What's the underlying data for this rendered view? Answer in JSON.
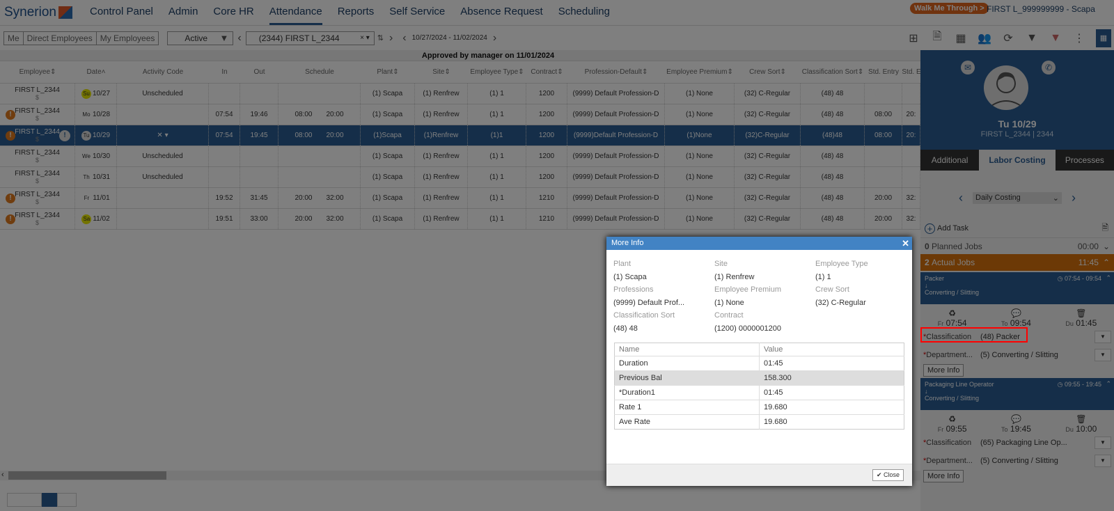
{
  "brand": "Synerion",
  "nav": [
    "Control Panel",
    "Admin",
    "Core HR",
    "Attendance",
    "Reports",
    "Self Service",
    "Absence Request",
    "Scheduling"
  ],
  "nav_active": "Attendance",
  "walk_me": "Walk Me Through >",
  "user": "FIRST L_999999999 - Scapa",
  "toolbar": {
    "scope": [
      "Me",
      "Direct Employees",
      "My Employees"
    ],
    "status": "Active",
    "employee": "(2344) FIRST L_2344",
    "date_range": "10/27/2024 - 11/02/2024"
  },
  "approval": "Approved by manager on 11/01/2024",
  "columns": [
    "Employee",
    "Date",
    "Activity Code",
    "In",
    "Out",
    "Schedule",
    "Plant",
    "Site",
    "Employee Type",
    "Contract",
    "Profession-Default",
    "Employee Premium",
    "Crew Sort",
    "Classification Sort",
    "Std. Entry",
    "Std. E"
  ],
  "rows": [
    {
      "emp": "FIRST L_2344",
      "day": "Su",
      "date": "10/27",
      "activity": "Unscheduled",
      "in": "",
      "out": "",
      "s1": "",
      "s2": "",
      "plant": "(1) Scapa",
      "site": "(1) Renfrew",
      "type": "(1) 1",
      "contract": "1200",
      "prof": "(9999) Default Profession-D",
      "prem": "(1) None",
      "crew": "(32) C-Regular",
      "cls": "(48) 48",
      "se": "",
      "sx": "",
      "warn": false
    },
    {
      "emp": "FIRST L_2344",
      "day": "Mo",
      "date": "10/28",
      "activity": "",
      "in": "07:54",
      "out": "19:46",
      "s1": "08:00",
      "s2": "20:00",
      "plant": "(1) Scapa",
      "site": "(1) Renfrew",
      "type": "(1) 1",
      "contract": "1200",
      "prof": "(9999) Default Profession-D",
      "prem": "(1) None",
      "crew": "(32) C-Regular",
      "cls": "(48) 48",
      "se": "08:00",
      "sx": "20:",
      "warn": true
    },
    {
      "emp": "FIRST L_2344",
      "day": "Tu",
      "date": "10/29",
      "activity": "✕ ▾",
      "in": "07:54",
      "out": "19:45",
      "s1": "08:00",
      "s2": "20:00",
      "plant": "(1)Scapa",
      "site": "(1)Renfrew",
      "type": "(1)1",
      "contract": "1200",
      "prof": "(9999)Default Profession-D",
      "prem": "(1)None",
      "crew": "(32)C-Regular",
      "cls": "(48)48",
      "se": "08:00",
      "sx": "20:",
      "warn": true,
      "selected": true
    },
    {
      "emp": "FIRST L_2344",
      "day": "We",
      "date": "10/30",
      "activity": "Unscheduled",
      "in": "",
      "out": "",
      "s1": "",
      "s2": "",
      "plant": "(1) Scapa",
      "site": "(1) Renfrew",
      "type": "(1) 1",
      "contract": "1200",
      "prof": "(9999) Default Profession-D",
      "prem": "(1) None",
      "crew": "(32) C-Regular",
      "cls": "(48) 48",
      "se": "",
      "sx": "",
      "warn": false
    },
    {
      "emp": "FIRST L_2344",
      "day": "Th",
      "date": "10/31",
      "activity": "Unscheduled",
      "in": "",
      "out": "",
      "s1": "",
      "s2": "",
      "plant": "(1) Scapa",
      "site": "(1) Renfrew",
      "type": "(1) 1",
      "contract": "1200",
      "prof": "(9999) Default Profession-D",
      "prem": "(1) None",
      "crew": "(32) C-Regular",
      "cls": "(48) 48",
      "se": "",
      "sx": "",
      "warn": false
    },
    {
      "emp": "FIRST L_2344",
      "day": "Fr",
      "date": "11/01",
      "activity": "",
      "in": "19:52",
      "out": "31:45",
      "s1": "20:00",
      "s2": "32:00",
      "plant": "(1) Scapa",
      "site": "(1) Renfrew",
      "type": "(1) 1",
      "contract": "1210",
      "prof": "(9999) Default Profession-D",
      "prem": "(1) None",
      "crew": "(32) C-Regular",
      "cls": "(48) 48",
      "se": "20:00",
      "sx": "32:",
      "warn": true
    },
    {
      "emp": "FIRST L_2344",
      "day": "Sa",
      "date": "11/02",
      "activity": "",
      "in": "19:51",
      "out": "33:00",
      "s1": "20:00",
      "s2": "32:00",
      "plant": "(1) Scapa",
      "site": "(1) Renfrew",
      "type": "(1) 1",
      "contract": "1210",
      "prof": "(9999) Default Profession-D",
      "prem": "(1) None",
      "crew": "(32) C-Regular",
      "cls": "(48) 48",
      "se": "20:00",
      "sx": "32:",
      "warn": true
    }
  ],
  "panel": {
    "day": "Tu 10/29",
    "employee": "FIRST L_2344 | 2344",
    "tabs": [
      "Additional",
      "Labor Costing",
      "Processes"
    ],
    "costing": "Daily Costing",
    "add_task": "Add Task",
    "planned": {
      "count": "0",
      "label": "Planned Jobs",
      "time": "00:00"
    },
    "actual": {
      "count": "2",
      "label": "Actual Jobs",
      "time": "11:45"
    },
    "jobs": [
      {
        "title": "Packer",
        "dept": "Converting / Slitting",
        "range": "07:54 - 09:54",
        "fr": "07:54",
        "to": "09:54",
        "du": "01:45",
        "classification": "(48) Packer",
        "department": "(5) Converting / Slitting"
      },
      {
        "title": "Packaging Line Operator",
        "dept": "Converting / Slitting",
        "range": "09:55 - 19:45",
        "fr": "09:55",
        "to": "19:45",
        "du": "10:00",
        "classification": "(65) Packaging Line Op...",
        "department": "(5) Converting / Slitting"
      }
    ],
    "labels": {
      "fr": "Fr",
      "to": "To",
      "du": "Du",
      "classification": "Classification",
      "department": "Department...",
      "more": "More Info"
    }
  },
  "modal": {
    "title": "More Info",
    "fields": [
      {
        "k": "Plant",
        "v": "(1) Scapa"
      },
      {
        "k": "Site",
        "v": "(1) Renfrew"
      },
      {
        "k": "Employee Type",
        "v": "(1) 1"
      },
      {
        "k": "Professions",
        "v": "(9999) Default Prof..."
      },
      {
        "k": "Employee Premium",
        "v": "(1) None"
      },
      {
        "k": "Crew Sort",
        "v": "(32) C-Regular"
      },
      {
        "k": "Classification Sort",
        "v": "(48) 48"
      },
      {
        "k": "Contract",
        "v": "(1200) 0000001200"
      }
    ],
    "table_headers": [
      "Name",
      "Value"
    ],
    "table": [
      [
        "Duration",
        "01:45"
      ],
      [
        "Previous Bal",
        "158.300"
      ],
      [
        "*Duration1",
        "01:45"
      ],
      [
        "Rate 1",
        "19.680"
      ],
      [
        "Ave Rate",
        "19.680"
      ]
    ],
    "close": "Close"
  },
  "colors": {
    "brand": "#2a5d93",
    "accent": "#e0661e",
    "highlight": "#ff0000"
  }
}
